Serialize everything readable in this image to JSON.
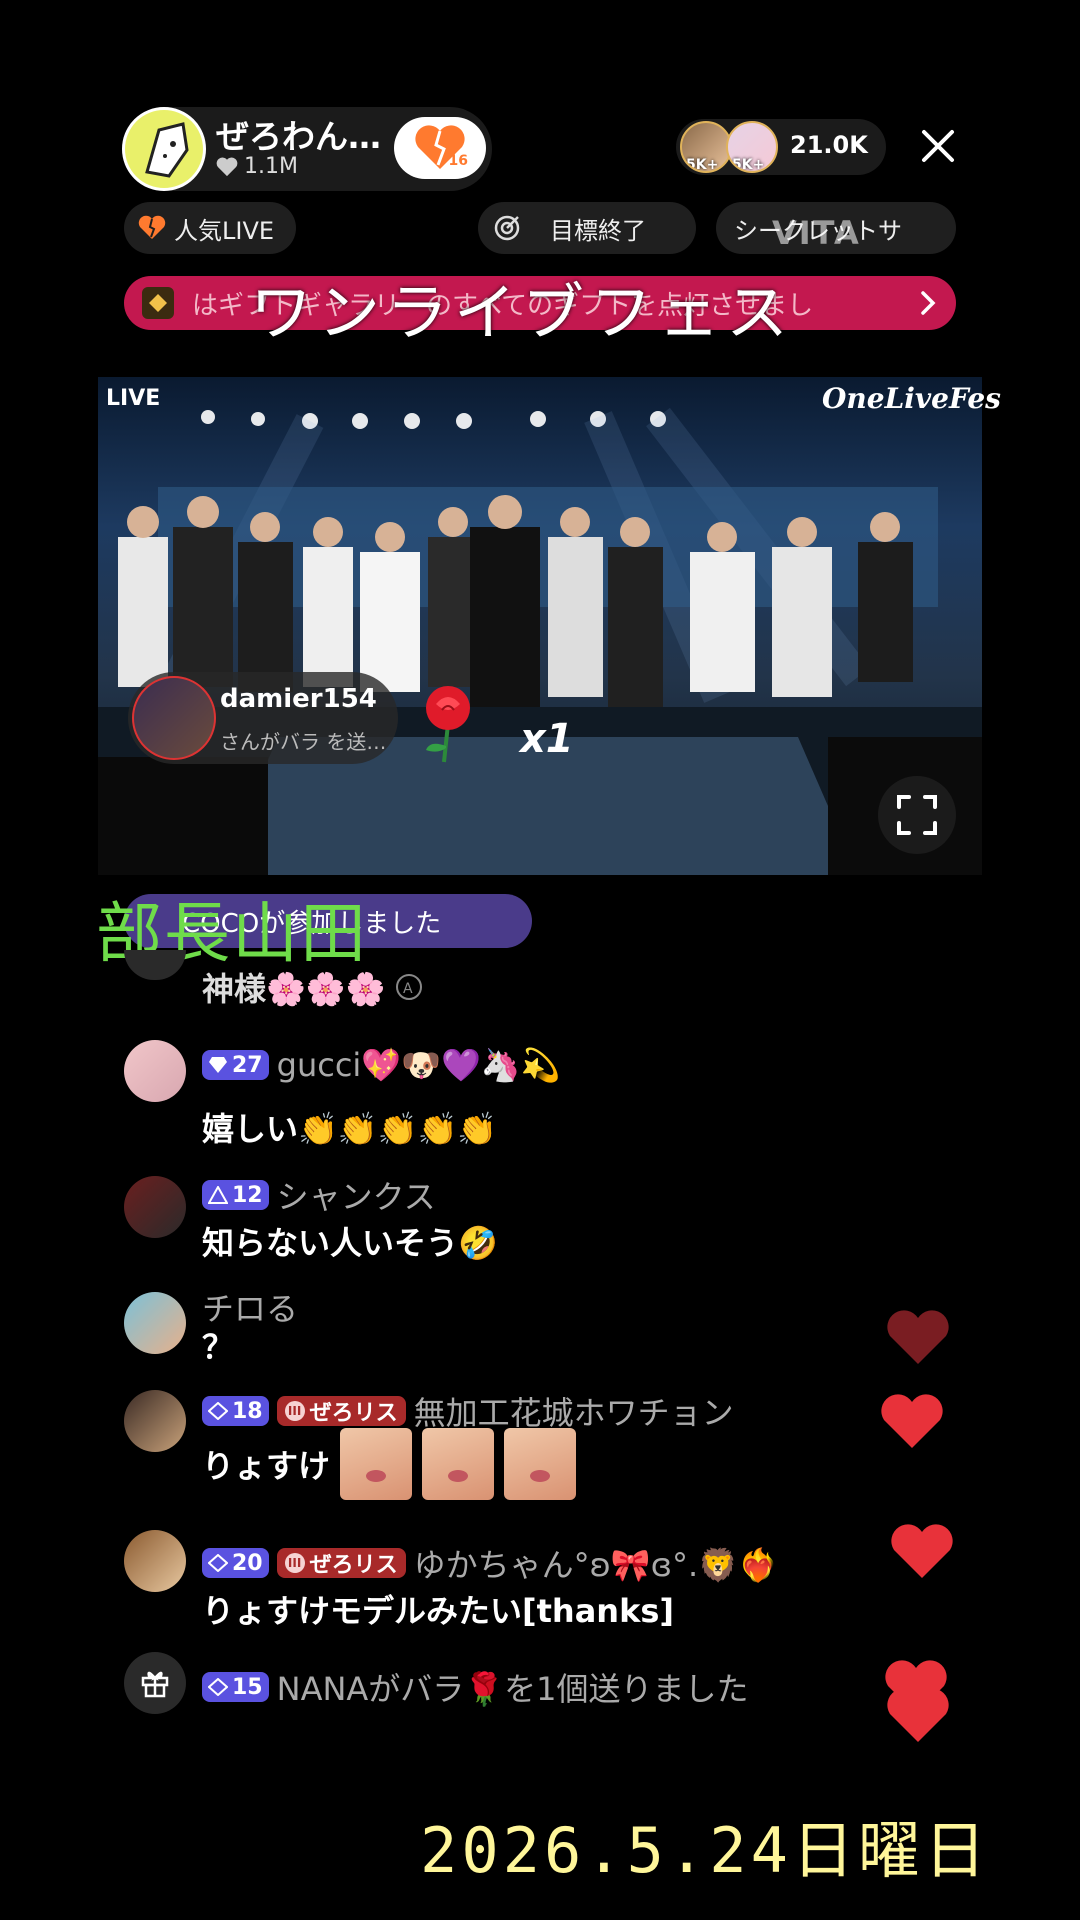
{
  "host": {
    "name": "ぜろわん…",
    "likes": "1.1M",
    "follow_count": "16"
  },
  "viewers": {
    "badge1": "5K+",
    "badge2": "5K+",
    "count": "21.0K"
  },
  "chips": {
    "popular": "人気LIVE",
    "goal": "目標終了",
    "secret": "シークレットサ"
  },
  "watermark": "VITA",
  "banner": {
    "text": "はギフトギャラリーのすべてのギフトを点灯させまし"
  },
  "overlay_title": "ワンライブフェス",
  "video": {
    "live_tag": "LIVE",
    "logo": "OneLiveFes",
    "gift_toast": {
      "user": "damier154",
      "message": "さんがバラ を送…",
      "multiplier": "x1"
    }
  },
  "chat": {
    "join_text": "COCOが参加しました",
    "join_overlay": "部長山田",
    "messages": [
      {
        "user": "",
        "text": "神様🌸🌸🌸"
      },
      {
        "level": "27",
        "user": "gucci💖🐶💜🦄💫",
        "text": "嬉しい👏👏👏👏👏"
      },
      {
        "level": "12",
        "user": "シャンクス",
        "text": "知らない人いそう🤣"
      },
      {
        "user": "チロる",
        "text": "？"
      },
      {
        "level": "18",
        "fan_badge": "ぜろリス",
        "user": "無加工花城ホワチョン",
        "text": "りょすけ"
      },
      {
        "level": "20",
        "fan_badge": "ぜろリス",
        "user": "ゆかちゃん°ʚ🎀ɞ°.🦁❤️‍🔥",
        "text": "りょすけモデルみたい[thanks]"
      },
      {
        "level": "15",
        "user": "NANAがバラ🌹を1個送りました",
        "text": ""
      }
    ]
  },
  "date_overlay": "2026.5.24日曜日",
  "colors": {
    "accent_red": "#c3184f",
    "level_badge": "#5a52e0",
    "fan_badge": "#a82a2a",
    "heart": "#e8323a"
  }
}
